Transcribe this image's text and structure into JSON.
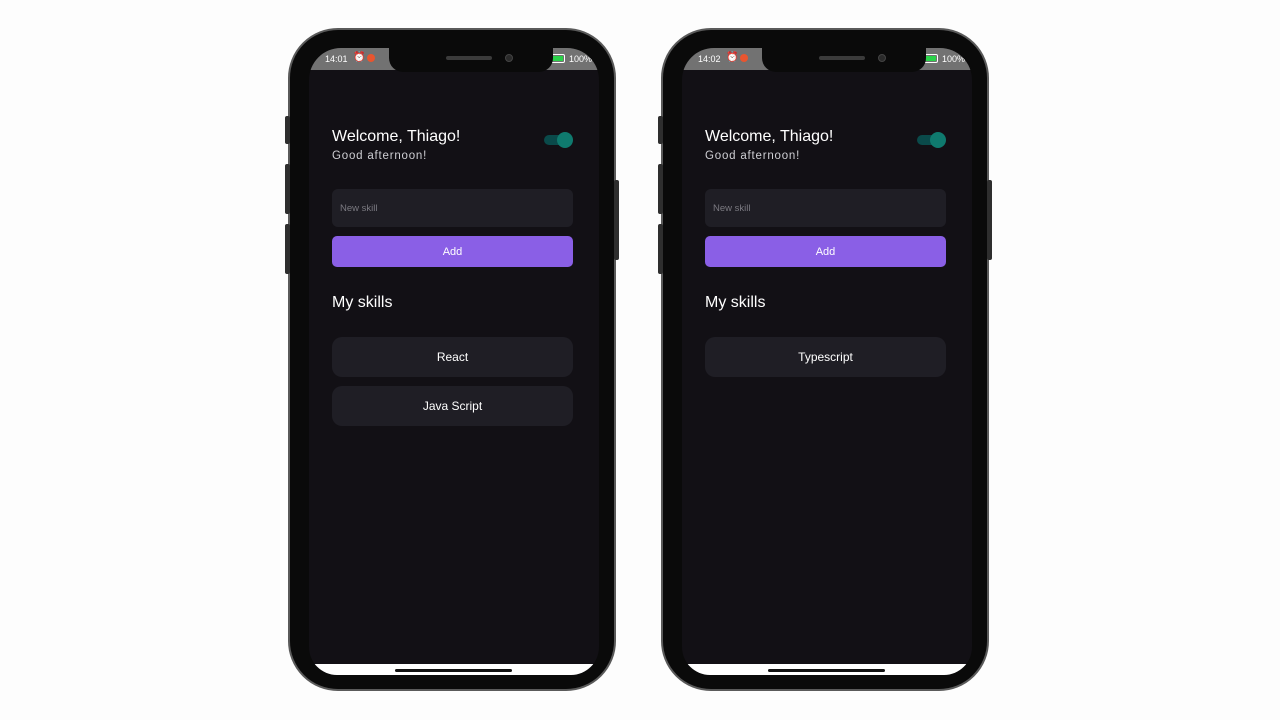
{
  "phones": [
    {
      "status": {
        "time": "14:01",
        "battery": "100%"
      },
      "greeting": "Welcome, Thiago!",
      "subgreeting": "Good afternoon!",
      "input": {
        "placeholder": "New skill",
        "value": ""
      },
      "add_label": "Add",
      "skills_title": "My skills",
      "skills": [
        "React",
        "Java Script"
      ]
    },
    {
      "status": {
        "time": "14:02",
        "battery": "100%"
      },
      "greeting": "Welcome, Thiago!",
      "subgreeting": "Good afternoon!",
      "input": {
        "placeholder": "New skill",
        "value": ""
      },
      "add_label": "Add",
      "skills_title": "My skills",
      "skills": [
        "Typescript"
      ]
    }
  ],
  "theme": {
    "background": "#121015",
    "card": "#1f1e25",
    "accent": "#8a5fe6",
    "toggle": "#0f7a6e"
  },
  "icons": {
    "alarm": "alarm-icon",
    "notification": "notification-icon",
    "wifi": "wifi-icon",
    "battery": "battery-icon"
  }
}
